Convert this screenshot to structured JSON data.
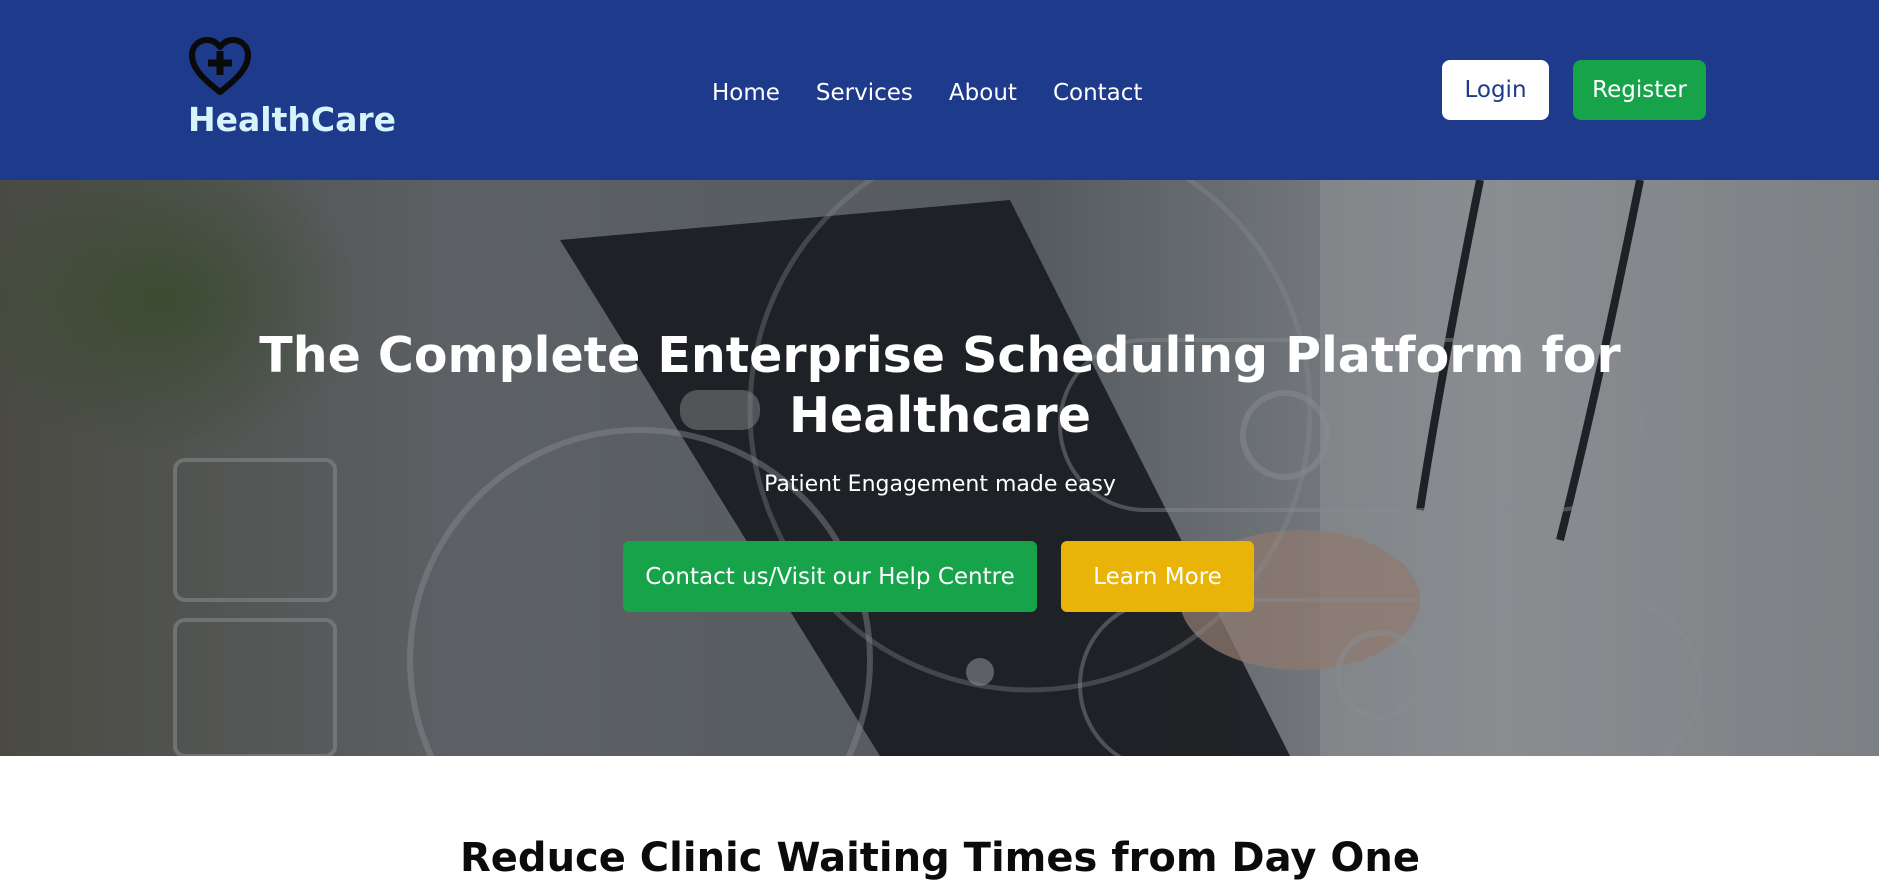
{
  "header": {
    "brand": "HealthCare",
    "logo_icon": "heart-plus-icon",
    "nav": [
      "Home",
      "Services",
      "About",
      "Contact"
    ],
    "login_label": "Login",
    "register_label": "Register"
  },
  "hero": {
    "background": "doctor-with-clipboard-medical-icons-image",
    "title": "The Complete Enterprise Scheduling Platform for Healthcare",
    "subtitle": "Patient Engagement made easy",
    "contact_label": "Contact us/Visit our Help Centre",
    "learn_more_label": "Learn More"
  },
  "section": {
    "title": "Reduce Clinic Waiting Times from Day One"
  },
  "colors": {
    "header_bg": "#1e3a8a",
    "brand_text": "#d7f3fb",
    "green": "#16a34a",
    "yellow": "#eab308"
  }
}
